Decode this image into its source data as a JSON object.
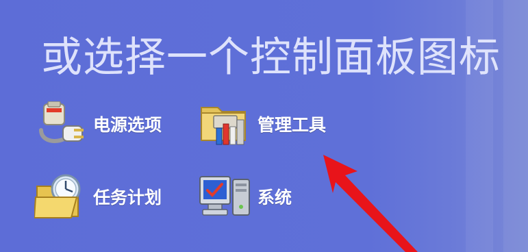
{
  "heading": "或选择一个控制面板图标",
  "items": [
    {
      "label": "电源选项",
      "icon": "power-plug-battery-icon"
    },
    {
      "label": "管理工具",
      "icon": "administrative-tools-icon"
    },
    {
      "label": "任务计划",
      "icon": "scheduled-tasks-folder-icon"
    },
    {
      "label": "系统",
      "icon": "system-monitor-icon"
    }
  ],
  "colors": {
    "background": "#5f6fd6",
    "text": "#ffffff",
    "arrow": "#e8141a"
  }
}
